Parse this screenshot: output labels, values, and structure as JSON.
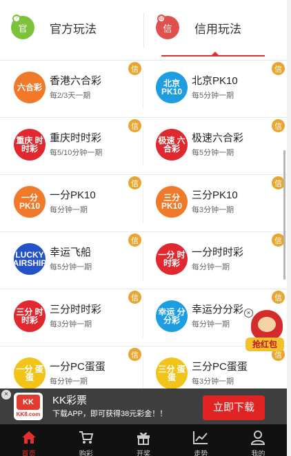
{
  "tabs": {
    "official": {
      "label": "官方玩法",
      "badge": "官",
      "mini": "?",
      "color": "#7cc23a"
    },
    "credit": {
      "label": "信用玩法",
      "badge": "信",
      "mini": "@",
      "color": "#e0514d"
    }
  },
  "xin_badge": "信",
  "games": [
    {
      "name": "香港六合彩",
      "desc": "每2/3天一期",
      "logo_text": "六合彩",
      "logo_color": "#f07a2a",
      "icon": "hk-mark-six-icon"
    },
    {
      "name": "北京PK10",
      "desc": "每5分钟一期",
      "logo_text": "北京 PK10",
      "logo_color": "#1e9ee0",
      "icon": "beijing-pk10-icon"
    },
    {
      "name": "重庆时时彩",
      "desc": "每5/10分钟一期",
      "logo_text": "重庆 时时彩",
      "logo_color": "#e0282e",
      "icon": "chongqing-ssc-icon"
    },
    {
      "name": "极速六合彩",
      "desc": "每5分钟一期",
      "logo_text": "极速 六合彩",
      "logo_color": "#e0282e",
      "icon": "speed-mark-six-icon"
    },
    {
      "name": "一分PK10",
      "desc": "每分钟一期",
      "logo_text": "一分 PK10",
      "logo_color": "#f07a2a",
      "icon": "one-min-pk10-icon"
    },
    {
      "name": "三分PK10",
      "desc": "每3分钟一期",
      "logo_text": "三分 PK10",
      "logo_color": "#f07a2a",
      "icon": "three-min-pk10-icon"
    },
    {
      "name": "幸运飞船",
      "desc": "每5分钟一期",
      "logo_text": "LUCKY AIRSHIP",
      "logo_color": "#2453c8",
      "icon": "lucky-airship-icon"
    },
    {
      "name": "一分时时彩",
      "desc": "每分钟一期",
      "logo_text": "一分 时时彩",
      "logo_color": "#e0282e",
      "icon": "one-min-ssc-icon"
    },
    {
      "name": "三分时时彩",
      "desc": "每3分钟一期",
      "logo_text": "三分 时时彩",
      "logo_color": "#e0282e",
      "icon": "three-min-ssc-icon"
    },
    {
      "name": "幸运分分彩",
      "desc": "每分钟一期",
      "logo_text": "幸运 分分彩",
      "logo_color": "#1e9ee0",
      "icon": "lucky-ffc-icon"
    },
    {
      "name": "一分PC蛋蛋",
      "desc": "每分钟一期",
      "logo_text": "一分 蛋蛋",
      "logo_color": "#f2c318",
      "icon": "one-min-pc-egg-icon"
    },
    {
      "name": "三分PC蛋蛋",
      "desc": "每3分钟一期",
      "logo_text": "三分 蛋蛋",
      "logo_color": "#f2c318",
      "icon": "three-min-pc-egg-icon"
    }
  ],
  "float_promo": {
    "text": "抢红包",
    "close": "×"
  },
  "app_banner": {
    "close": "×",
    "logo_text": "KK",
    "logo_domain": "KK8.com",
    "title": "KK彩票",
    "subtitle": "下载APP，即可获得38元彩金！！",
    "button": "立即下载"
  },
  "bottom_nav": [
    {
      "label": "首页",
      "icon": "home-icon",
      "active": true
    },
    {
      "label": "购彩",
      "icon": "cart-icon",
      "active": false
    },
    {
      "label": "开奖",
      "icon": "gift-icon",
      "active": false
    },
    {
      "label": "走势",
      "icon": "chart-icon",
      "active": false
    },
    {
      "label": "我的",
      "icon": "user-icon",
      "active": false
    }
  ],
  "colors": {
    "accent": "#e23030",
    "xin_badge": "#e8a530",
    "nav_bg": "#111111"
  }
}
